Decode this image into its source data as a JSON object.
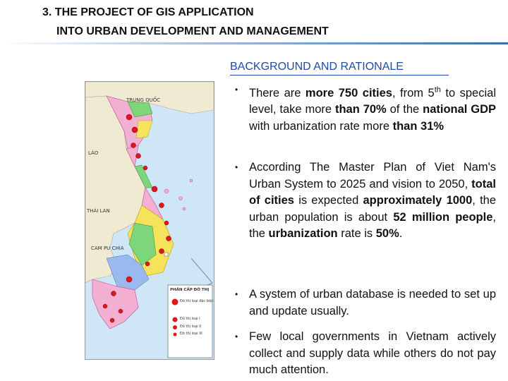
{
  "header": {
    "title_line1": "3. THE PROJECT OF GIS APPLICATION",
    "title_line2": "INTO URBAN DEVELOPMENT AND MANAGEMENT"
  },
  "section": {
    "title": "BACKGROUND AND RATIONALE"
  },
  "map": {
    "labels": {
      "trung_quoc": "TRUNG QUỐC",
      "lao": "LÀO",
      "thai_lan": "THÁI LAN",
      "cam_pu_chia": "CAM PU CHIA",
      "legend_title": "PHÂN CẤP ĐÔ THỊ",
      "legend_special": "Đô thị loại đặc biệt",
      "legend_1": "Đô thị loại I",
      "legend_2": "Đô thị loại II",
      "legend_3": "Đô thị loại III"
    },
    "colors": {
      "sea": "#cfe6f6",
      "marker": "#e0161c"
    }
  },
  "bullets": [
    {
      "parts": [
        {
          "t": "There are ",
          "b": false
        },
        {
          "t": "more 750 cities",
          "b": true
        },
        {
          "t": ", from 5",
          "b": false
        },
        {
          "t": "th",
          "sup": true
        },
        {
          "t": " to special level, take more ",
          "b": false
        },
        {
          "t": "than 70%",
          "b": true
        },
        {
          "t": " of the ",
          "b": false
        },
        {
          "t": "national GDP",
          "b": true
        },
        {
          "t": " with urbanization rate more ",
          "b": false
        },
        {
          "t": "than 31%",
          "b": true
        }
      ]
    },
    {
      "parts": [
        {
          "t": "According The Master Plan of Viet Nam's Urban System to 2025 and vision to 2050, ",
          "b": false
        },
        {
          "t": "total of cities",
          "b": true
        },
        {
          "t": " is expected ",
          "b": false
        },
        {
          "t": "approximately 1000",
          "b": true
        },
        {
          "t": ", the urban population is about ",
          "b": false
        },
        {
          "t": "52 million people",
          "b": true
        },
        {
          "t": ", the ",
          "b": false
        },
        {
          "t": "urbanization",
          "b": true
        },
        {
          "t": " rate is ",
          "b": false
        },
        {
          "t": "50%",
          "b": true
        },
        {
          "t": ".",
          "b": false
        }
      ]
    },
    {
      "parts": [
        {
          "t": "A system of urban database is needed to set up and update usually.",
          "b": false
        }
      ]
    },
    {
      "parts": [
        {
          "t": "Few local governments in Vietnam actively collect and supply data while others do not pay much attention.",
          "b": false
        }
      ]
    }
  ]
}
